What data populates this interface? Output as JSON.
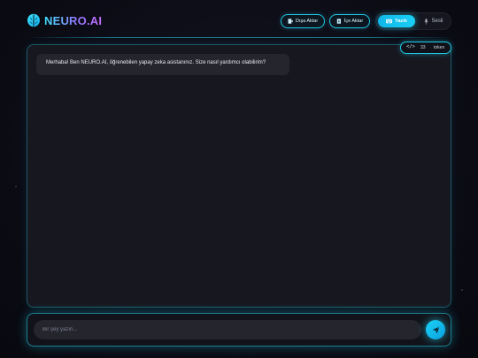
{
  "brand": {
    "name": "NEURO.AI",
    "icon": "brain-icon"
  },
  "header": {
    "export_label": "Dışa Aktar",
    "import_label": "İçe Aktar",
    "modes": {
      "text_label": "Yazılı",
      "voice_label": "Sesli",
      "active": "text"
    }
  },
  "token_counter": {
    "icon": "code-icon",
    "count": "33",
    "unit": "token"
  },
  "messages": [
    {
      "role": "assistant",
      "text": "Merhaba! Ben NEURO.AI, öğrenebilen yapay zeka asistanınız. Size nasıl yardımcı olabilirim?"
    }
  ],
  "composer": {
    "placeholder": "Bir şey yazın...",
    "value": "",
    "send_icon": "send-icon"
  },
  "colors": {
    "accent": "#22d3ee",
    "background": "#0b0b14",
    "panel": "#17171f",
    "bubble": "#25252e"
  }
}
